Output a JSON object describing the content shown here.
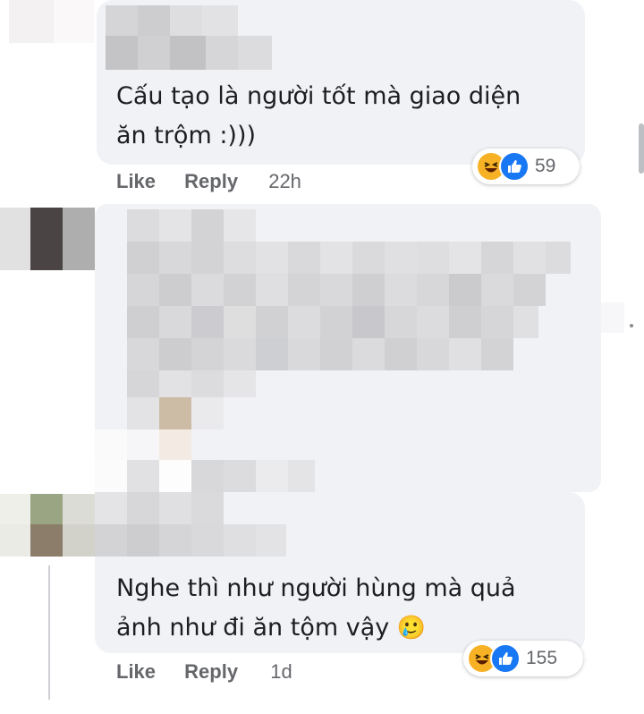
{
  "comment1": {
    "text_line1": "Cấu tạo là người tốt mà giao diện",
    "text_line2": "ăn trộm :)))",
    "like": "Like",
    "reply": "Reply",
    "time": "22h",
    "reaction_count": "59",
    "reactions": [
      "haha-icon",
      "like-icon"
    ]
  },
  "comment3": {
    "text_line1": "Nghe thì như người hùng mà quả",
    "text_line2": "ảnh như đi ăn tộm vậy",
    "emoji": "🥲",
    "like": "Like",
    "reply": "Reply",
    "time": "1d",
    "reaction_count": "155",
    "reactions": [
      "haha-icon",
      "like-icon"
    ]
  },
  "colors": {
    "bubble": "#f0f2f5",
    "meta_text": "#65676b",
    "like_blue": "#1877f2",
    "haha_yellow": "#f7b125"
  }
}
